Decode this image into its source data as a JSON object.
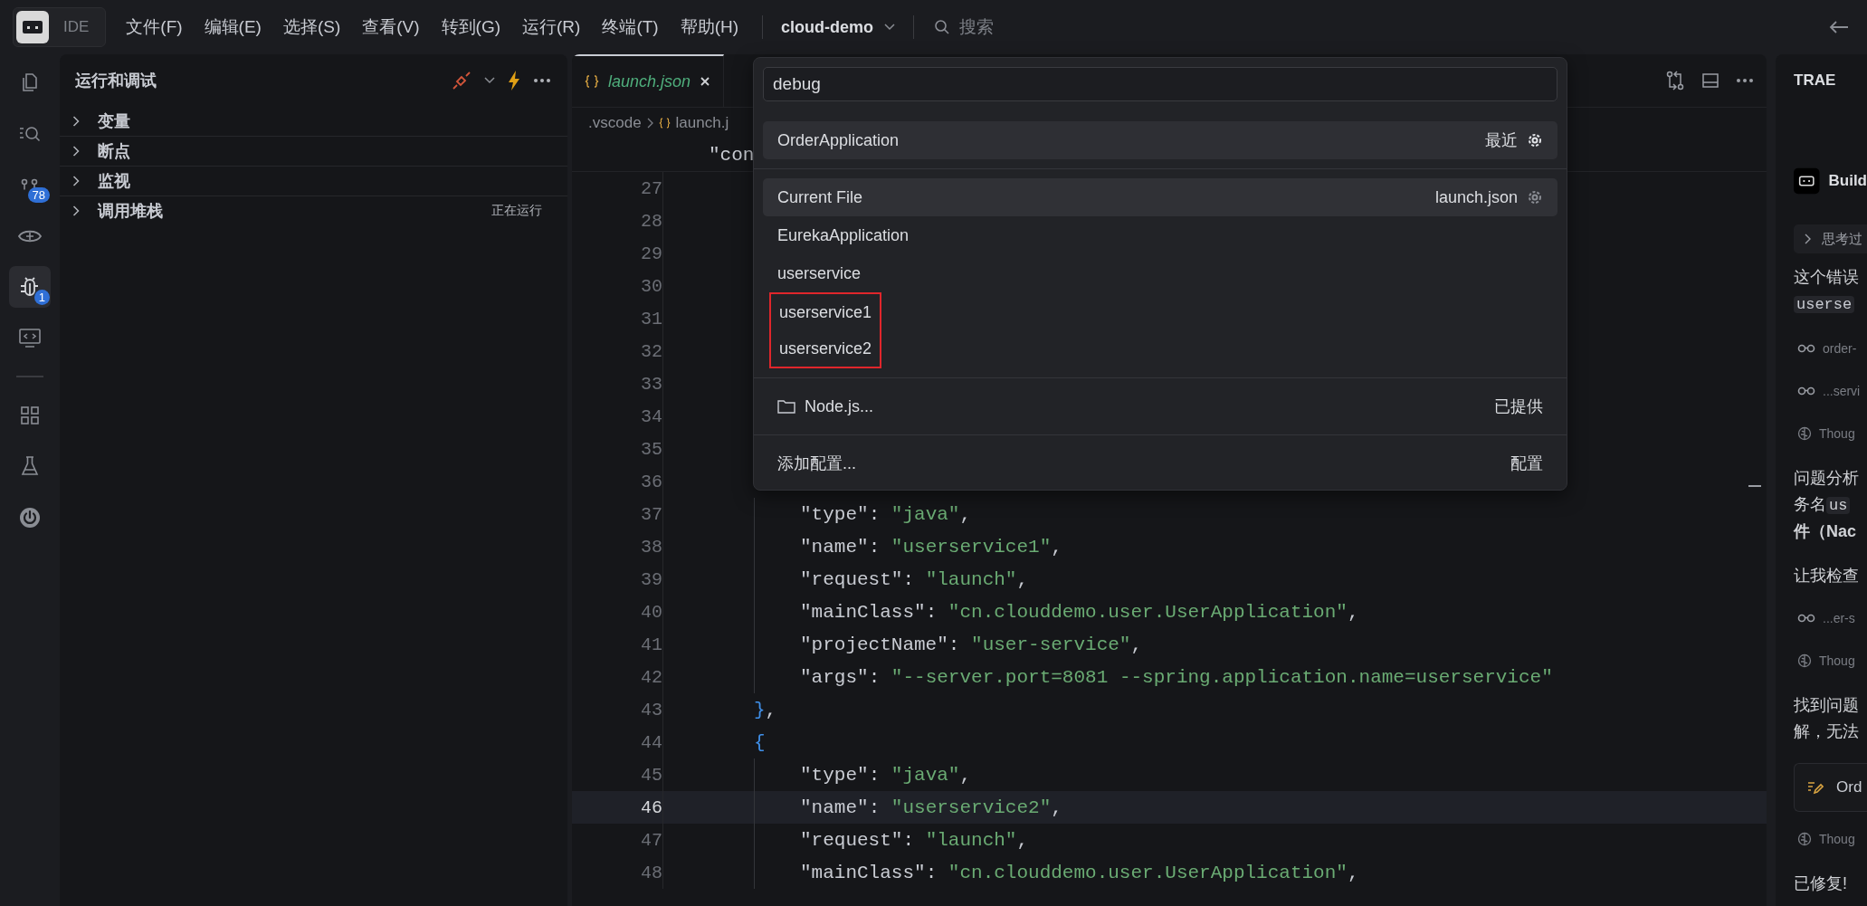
{
  "menubar": {
    "app_label": "IDE",
    "menus": [
      "文件(F)",
      "编辑(E)",
      "选择(S)",
      "查看(V)",
      "转到(G)",
      "运行(R)",
      "终端(T)",
      "帮助(H)"
    ],
    "project": "cloud-demo",
    "search_placeholder": "搜索"
  },
  "activity_bar": {
    "top": [
      {
        "kind": "files",
        "selected": false
      },
      {
        "kind": "search",
        "selected": false
      },
      {
        "kind": "source-control",
        "badge": "78",
        "selected": false
      },
      {
        "kind": "eye",
        "selected": false
      },
      {
        "kind": "debug",
        "badge": "1",
        "selected": true
      },
      {
        "kind": "remote",
        "selected": false
      }
    ],
    "bottom": [
      {
        "kind": "extensions",
        "selected": false
      },
      {
        "kind": "flask",
        "selected": false
      },
      {
        "kind": "power",
        "selected": false
      }
    ]
  },
  "sidebar": {
    "title": "运行和调试",
    "sections": [
      {
        "label": "变量",
        "expanded": false
      },
      {
        "label": "断点",
        "expanded": false
      },
      {
        "label": "监视",
        "expanded": false
      },
      {
        "label": "调用堆栈",
        "expanded": false,
        "status": "正在运行"
      }
    ]
  },
  "editor": {
    "tabs": [
      {
        "label": "launch.json",
        "selected": true
      }
    ],
    "breadcrumb": [
      {
        "label": ".vscode",
        "kind": "folder"
      },
      {
        "label": "launch.j",
        "kind": "json"
      }
    ],
    "sticky_line": "\"con",
    "lines": [
      {
        "number": "27",
        "kind": "hidden",
        "current": false
      },
      {
        "number": "28",
        "kind": "hidden",
        "current": false
      },
      {
        "number": "29",
        "kind": "hidden",
        "current": false
      },
      {
        "number": "30",
        "kind": "hidden",
        "current": false
      },
      {
        "number": "31",
        "kind": "hidden",
        "current": false
      },
      {
        "number": "32",
        "kind": "hidden",
        "current": false
      },
      {
        "number": "33",
        "kind": "hidden",
        "current": false
      },
      {
        "number": "34",
        "kind": "hidden",
        "current": false
      },
      {
        "number": "35",
        "kind": "hidden",
        "current": false
      },
      {
        "number": "36",
        "kind": "hidden",
        "current": false
      },
      {
        "number": "37",
        "kind": "member",
        "current": false,
        "tokens": [
          {
            "text": "\"type\"",
            "kind": "key"
          },
          {
            "text": ": ",
            "kind": "punct"
          },
          {
            "text": "\"java\"",
            "kind": "string"
          },
          {
            "text": ",",
            "kind": "punct"
          }
        ]
      },
      {
        "number": "38",
        "kind": "member",
        "current": false,
        "tokens": [
          {
            "text": "\"name\"",
            "kind": "key"
          },
          {
            "text": ": ",
            "kind": "punct"
          },
          {
            "text": "\"userservice1\"",
            "kind": "string"
          },
          {
            "text": ",",
            "kind": "punct"
          }
        ]
      },
      {
        "number": "39",
        "kind": "member",
        "current": false,
        "tokens": [
          {
            "text": "\"request\"",
            "kind": "key"
          },
          {
            "text": ": ",
            "kind": "punct"
          },
          {
            "text": "\"launch\"",
            "kind": "string"
          },
          {
            "text": ",",
            "kind": "punct"
          }
        ]
      },
      {
        "number": "40",
        "kind": "member",
        "current": false,
        "tokens": [
          {
            "text": "\"mainClass\"",
            "kind": "key"
          },
          {
            "text": ": ",
            "kind": "punct"
          },
          {
            "text": "\"cn.clouddemo.user.UserApplication\"",
            "kind": "string"
          },
          {
            "text": ",",
            "kind": "punct"
          }
        ]
      },
      {
        "number": "41",
        "kind": "member",
        "current": false,
        "tokens": [
          {
            "text": "\"projectName\"",
            "kind": "key"
          },
          {
            "text": ": ",
            "kind": "punct"
          },
          {
            "text": "\"user-service\"",
            "kind": "string"
          },
          {
            "text": ",",
            "kind": "punct"
          }
        ]
      },
      {
        "number": "42",
        "kind": "member",
        "current": false,
        "tokens": [
          {
            "text": "\"args\"",
            "kind": "key"
          },
          {
            "text": ": ",
            "kind": "punct"
          },
          {
            "text": "\"--server.port=8081 --spring.application.name=userservice\"",
            "kind": "string"
          }
        ]
      },
      {
        "number": "43",
        "kind": "brace",
        "current": false,
        "tokens": [
          {
            "text": "}",
            "kind": "brace"
          },
          {
            "text": ",",
            "kind": "punct"
          }
        ]
      },
      {
        "number": "44",
        "kind": "brace",
        "current": false,
        "tokens": [
          {
            "text": "{",
            "kind": "brace"
          }
        ]
      },
      {
        "number": "45",
        "kind": "member",
        "current": false,
        "tokens": [
          {
            "text": "\"type\"",
            "kind": "key"
          },
          {
            "text": ": ",
            "kind": "punct"
          },
          {
            "text": "\"java\"",
            "kind": "string"
          },
          {
            "text": ",",
            "kind": "punct"
          }
        ]
      },
      {
        "number": "46",
        "kind": "member",
        "current": true,
        "tokens": [
          {
            "text": "\"name\"",
            "kind": "key"
          },
          {
            "text": ": ",
            "kind": "punct"
          },
          {
            "text": "\"userservice2\"",
            "kind": "string"
          },
          {
            "text": ",",
            "kind": "punct"
          }
        ]
      },
      {
        "number": "47",
        "kind": "member",
        "current": false,
        "tokens": [
          {
            "text": "\"request\"",
            "kind": "key"
          },
          {
            "text": ": ",
            "kind": "punct"
          },
          {
            "text": "\"launch\"",
            "kind": "string"
          },
          {
            "text": ",",
            "kind": "punct"
          }
        ]
      },
      {
        "number": "48",
        "kind": "member",
        "current": false,
        "tokens": [
          {
            "text": "\"mainClass\"",
            "kind": "key"
          },
          {
            "text": ": ",
            "kind": "punct"
          },
          {
            "text": "\"cn.clouddemo.user.UserApplication\"",
            "kind": "string"
          },
          {
            "text": ",",
            "kind": "punct"
          }
        ]
      }
    ]
  },
  "quick_pick": {
    "query": "debug",
    "recent": {
      "label": "OrderApplication",
      "detail": "最近"
    },
    "configs": [
      {
        "label": "Current File",
        "detail": "launch.json",
        "selected": true,
        "annotated": false
      },
      {
        "label": "EurekaApplication",
        "selected": false,
        "annotated": false
      },
      {
        "label": "userservice",
        "selected": false,
        "annotated": false
      },
      {
        "label": "userservice1",
        "selected": false,
        "annotated": true
      },
      {
        "label": "userservice2",
        "selected": false,
        "annotated": true
      }
    ],
    "provided": {
      "label": "Node.js...",
      "detail": "已提供"
    },
    "add": {
      "label": "添加配置...",
      "detail": "配置"
    }
  },
  "assistant": {
    "title": "TRAE",
    "items": [
      {
        "kind": "agent",
        "text": "Build"
      },
      {
        "kind": "chip",
        "text": "思考过"
      },
      {
        "kind": "text",
        "text": "这个错误"
      },
      {
        "kind": "code",
        "text": "userse"
      },
      {
        "kind": "tool",
        "text": "order-"
      },
      {
        "kind": "tool",
        "text": "...servi"
      },
      {
        "kind": "thought",
        "text": "Thoug"
      },
      {
        "kind": "text",
        "text": "问题分析"
      },
      {
        "kind": "text",
        "text": "务名",
        "code": "us"
      },
      {
        "kind": "strong",
        "text": "件（Nac"
      },
      {
        "kind": "text",
        "text": "让我检查"
      },
      {
        "kind": "tool",
        "text": "...er-s"
      },
      {
        "kind": "thought",
        "text": "Thoug"
      },
      {
        "kind": "text",
        "text": "找到问题"
      },
      {
        "kind": "text",
        "text": "解，无法"
      },
      {
        "kind": "card",
        "text": "Ord"
      },
      {
        "kind": "thought",
        "text": "Thoug"
      },
      {
        "kind": "text",
        "text": "已修复!"
      }
    ]
  }
}
